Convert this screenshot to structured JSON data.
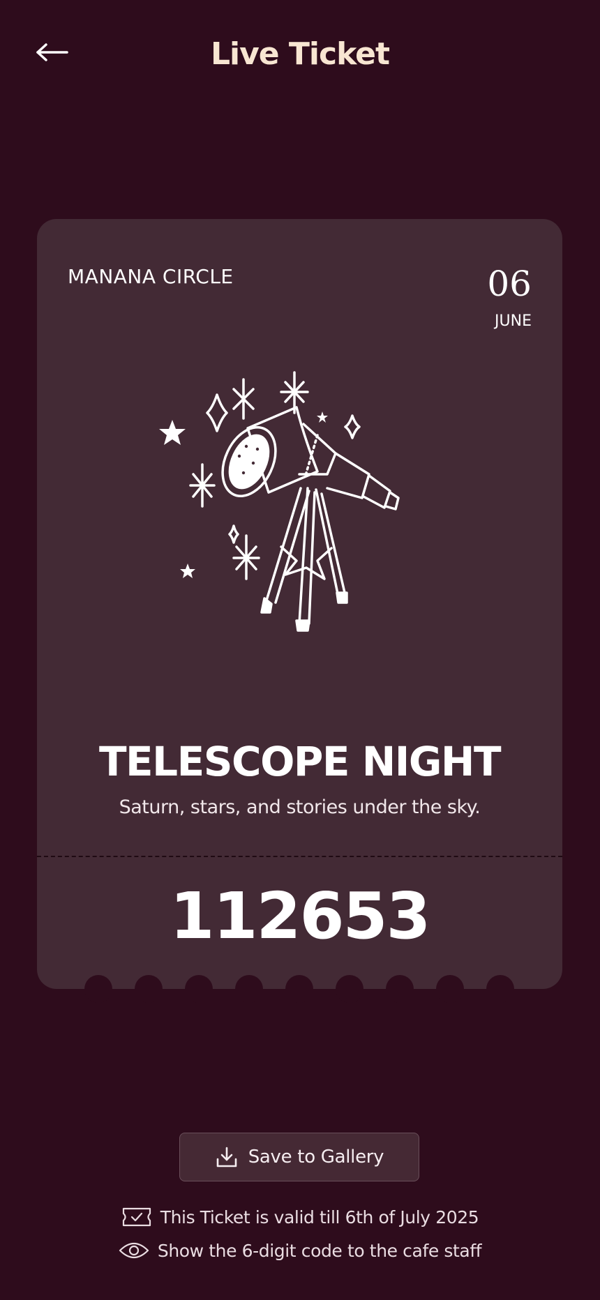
{
  "header": {
    "title": "Live Ticket",
    "back_icon": "arrow-left-icon"
  },
  "ticket": {
    "organizer": "MANANA CIRCLE",
    "date_day": "06",
    "date_month": "JUNE",
    "illustration": "telescope-stars-illustration",
    "event_title": "TELESCOPE NIGHT",
    "event_subtitle": "Saturn, stars, and stories under the sky.",
    "code": "112653"
  },
  "actions": {
    "save_label": "Save to Gallery",
    "save_icon": "download-icon"
  },
  "info": {
    "validity_text": "This Ticket is valid till 6th of July 2025",
    "validity_icon": "ticket-check-icon",
    "instruction_text": "Show the 6-digit code to the cafe staff",
    "instruction_icon": "eye-icon"
  },
  "colors": {
    "background": "#2e0c1c",
    "ticket": "#432a35",
    "title": "#f8e6d2",
    "text": "#ffffff"
  }
}
